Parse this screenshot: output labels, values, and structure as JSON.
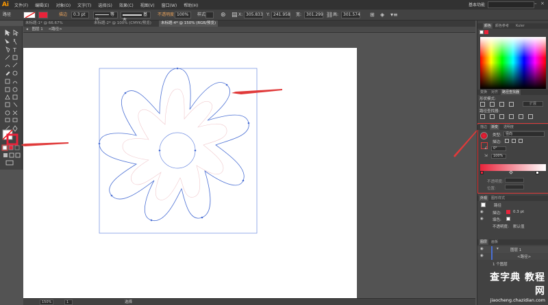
{
  "app": {
    "logo": "Ai",
    "menu": [
      "文件(F)",
      "编辑(E)",
      "对象(O)",
      "文字(T)",
      "选择(S)",
      "效果(C)",
      "视图(V)",
      "窗口(W)",
      "帮助(H)"
    ],
    "workspace": "基本功能"
  },
  "control_bar": {
    "selection_label": "路径",
    "stroke_label": "描边",
    "stroke_value": "0.3 pt",
    "stroke_profile": "等比",
    "brush": "基本",
    "opacity_label": "不透明度",
    "opacity_value": "100%",
    "style_label": "样式",
    "x_value": "305.833",
    "y_value": "241.958",
    "w_value": "301.299",
    "h_value": "301.574"
  },
  "doc_tabs": [
    "未标题-1* @ 66.67% (CMYK/预览)",
    "未标题-2* @ 100% (CMYK/预览)",
    "未标题-4* @ 150% (RGB/预览)"
  ],
  "breadcrumb": [
    "图层 1",
    "<路径>"
  ],
  "color_panel": {
    "tabs": [
      "颜色",
      "颜色参考",
      "Kuler"
    ]
  },
  "pathfinder_panel": {
    "tabs": [
      "变换",
      "对齐",
      "路径查找器"
    ],
    "shape_modes": "形状模式:",
    "pathfinders": "路径查找器:",
    "expand": "扩展"
  },
  "gradient_panel": {
    "tabs": [
      "描边",
      "渐变",
      "透明度"
    ],
    "type_label": "类型:",
    "type_value": "径向",
    "stroke_label": "描边:",
    "angle_value": "0°",
    "ratio_value": "100%",
    "opacity_label": "不透明度:",
    "location_label": "位置:",
    "start_color": "#e8233a",
    "end_color": "#ffffff"
  },
  "appearance_panel": {
    "tabs": [
      "外观",
      "图形样式"
    ],
    "title": "路径",
    "stroke_label": "描边:",
    "stroke_value": "0.3 pt",
    "fill_label": "填色:",
    "opacity_label": "不透明度:",
    "opacity_value": "默认值"
  },
  "layers_panel": {
    "tabs": [
      "图层",
      "画板"
    ],
    "layer_name": "图层 1",
    "sublayer": "<路径>",
    "status": "1 个图层"
  },
  "status_bar": {
    "zoom": "150%",
    "page": "1",
    "tool": "选择"
  },
  "watermark": {
    "title": "查字典 教程 网",
    "url": "jiaocheng.chazidian.com"
  },
  "colors": {
    "accent_red": "#e8233a",
    "path_blue": "#4a6fd4",
    "arrow_red": "#e03a3a"
  }
}
